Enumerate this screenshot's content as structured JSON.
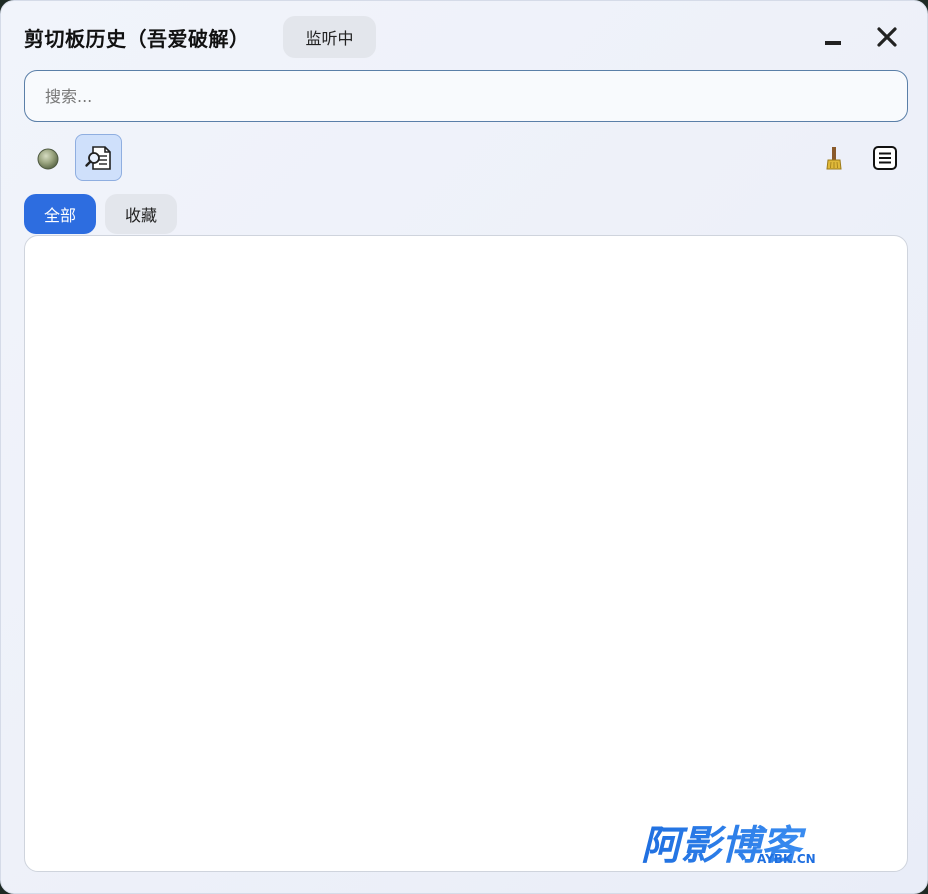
{
  "window": {
    "title": "剪切板历史（吾爱破解）",
    "status_badge": "监听中"
  },
  "search": {
    "placeholder": "搜索...",
    "value": ""
  },
  "toolbar": {
    "left_icons": [
      "status-dot-icon",
      "search-document-icon"
    ],
    "right_icons": [
      "broom-icon",
      "list-icon"
    ]
  },
  "tabs": [
    {
      "label": "全部",
      "active": true
    },
    {
      "label": "收藏",
      "active": false
    }
  ],
  "watermark": {
    "main": "阿影博客",
    "sub": "AYBK.CN"
  },
  "colors": {
    "accent": "#2d6de0",
    "badge_bg": "#e3e6ec",
    "window_bg": "#eef1f9"
  }
}
